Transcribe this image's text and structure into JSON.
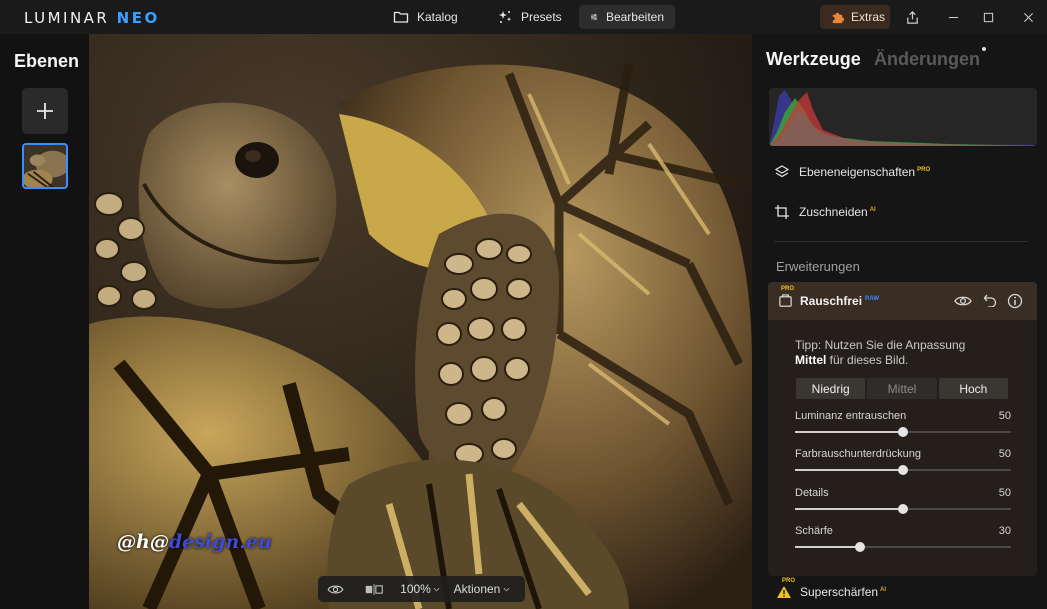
{
  "app": {
    "logo_main": "LUMINAR",
    "logo_accent": "NEO"
  },
  "nav": {
    "katalog": "Katalog",
    "presets": "Presets",
    "bearbeiten": "Bearbeiten",
    "active": "bearbeiten"
  },
  "extras_label": "Extras",
  "layers": {
    "title": "Ebenen"
  },
  "canvas": {
    "watermark_part1": "@h@",
    "watermark_part2": "design.eu",
    "zoom": "100%",
    "actions": "Aktionen"
  },
  "tools": {
    "tab_tools": "Werkzeuge",
    "tab_changes": "Änderungen",
    "layer_props": "Ebeneneigenschaften",
    "layer_props_badge": "PRO",
    "crop": "Zuschneiden",
    "crop_badge": "AI",
    "section_extensions": "Erweiterungen",
    "extension": {
      "name": "Rauschfrei",
      "pro_badge": "PRO",
      "raw_badge": "RAW",
      "tip_line1": "Tipp: Nutzen Sie die Anpassung",
      "tip_bold": "Mittel",
      "tip_rest": " für dieses Bild.",
      "modes": [
        "Niedrig",
        "Mittel",
        "Hoch"
      ],
      "sliders": [
        {
          "label": "Luminanz entrauschen",
          "value": "50",
          "fraction": 0.5
        },
        {
          "label": "Farbrauschunterdrückung",
          "value": "50",
          "fraction": 0.5
        },
        {
          "label": "Details",
          "value": "50",
          "fraction": 0.5
        },
        {
          "label": "Schärfe",
          "value": "30",
          "fraction": 0.3
        }
      ]
    },
    "super_sharpen": "Superschärfen",
    "super_pro_badge": "PRO",
    "super_ai_badge": "AI"
  },
  "colors": {
    "accent_blue": "#3a8bff",
    "extension_header": "#3a2d23",
    "pro_badge": "#f0c020"
  }
}
